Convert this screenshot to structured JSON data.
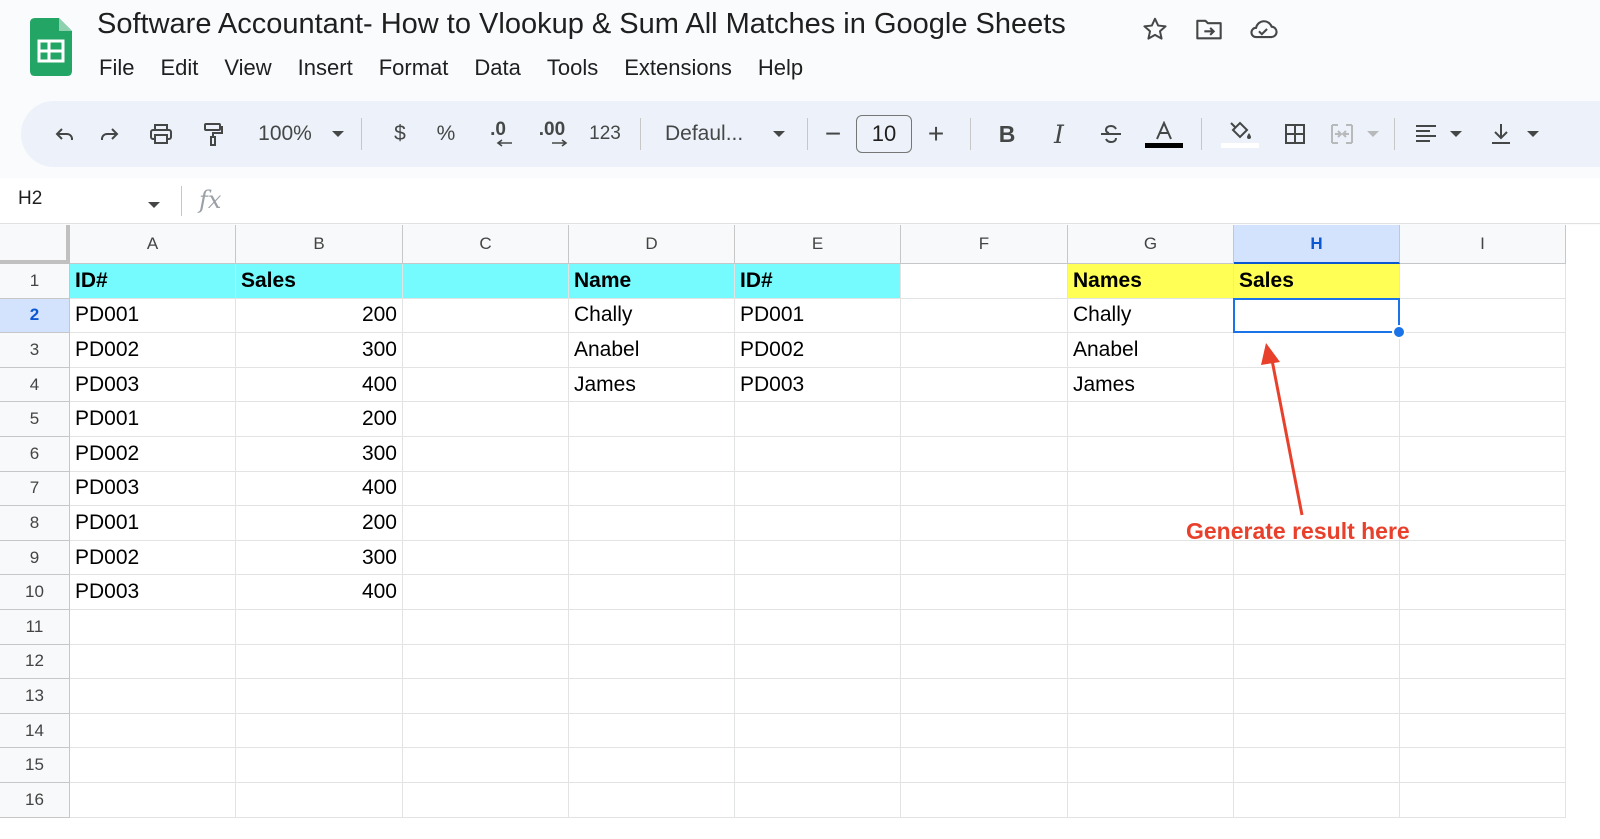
{
  "app": {
    "title": "Software Accountant- How to Vlookup & Sum All Matches in Google Sheets",
    "logo_icon": "sheets-logo-icon",
    "title_icons": [
      "star-icon",
      "move-to-folder-icon",
      "cloud-status-icon"
    ]
  },
  "menu": [
    "File",
    "Edit",
    "View",
    "Insert",
    "Format",
    "Data",
    "Tools",
    "Extensions",
    "Help"
  ],
  "toolbar": {
    "zoom": "100%",
    "currency": "$",
    "percent": "%",
    "decrease_decimal": ".0",
    "increase_decimal": ".00",
    "number_format": "123",
    "font": "Defaul...",
    "minus": "−",
    "font_size": "10",
    "plus": "+",
    "bold": "B",
    "italic": "I",
    "text_color": "#000000",
    "fill_color": "#ffffff"
  },
  "formula_bar": {
    "name_box": "H2",
    "fx": "fx",
    "value": ""
  },
  "columns": [
    "A",
    "B",
    "C",
    "D",
    "E",
    "F",
    "G",
    "H",
    "I"
  ],
  "rows": [
    "1",
    "2",
    "3",
    "4",
    "5",
    "6",
    "7",
    "8",
    "9",
    "10",
    "11",
    "12",
    "13",
    "14",
    "15",
    "16"
  ],
  "selected": {
    "column": "H",
    "row": "2",
    "cell": "H2"
  },
  "cells": {
    "A1": "ID#",
    "B1": "Sales",
    "D1": "Name",
    "E1": "ID#",
    "G1": "Names",
    "H1": "Sales",
    "A2": "PD001",
    "B2": "200",
    "D2": "Chally",
    "E2": "PD001",
    "G2": "Chally",
    "A3": "PD002",
    "B3": "300",
    "D3": "Anabel",
    "E3": "PD002",
    "G3": "Anabel",
    "A4": "PD003",
    "B4": "400",
    "D4": "James",
    "E4": "PD003",
    "G4": "James",
    "A5": "PD001",
    "B5": "200",
    "A6": "PD002",
    "B6": "300",
    "A7": "PD003",
    "B7": "400",
    "A8": "PD001",
    "B8": "200",
    "A9": "PD002",
    "B9": "300",
    "A10": "PD003",
    "B10": "400"
  },
  "header_fill": {
    "cyan": "#75fafd",
    "yellow": "#ffff55"
  },
  "annotation": {
    "text": "Generate result here",
    "color": "#e8402b"
  },
  "colors": {
    "selection": "#1a73e8",
    "selected_header": "#d3e3fd",
    "toolbar_bg": "#edf2fa"
  }
}
